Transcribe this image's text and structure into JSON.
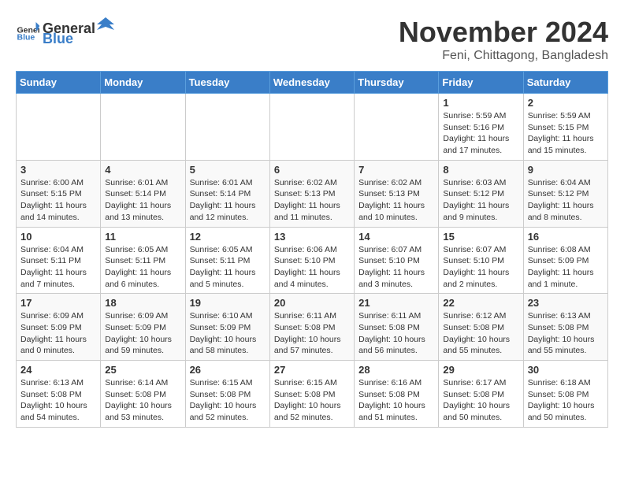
{
  "logo": {
    "general": "General",
    "blue": "Blue"
  },
  "title": "November 2024",
  "location": "Feni, Chittagong, Bangladesh",
  "headers": [
    "Sunday",
    "Monday",
    "Tuesday",
    "Wednesday",
    "Thursday",
    "Friday",
    "Saturday"
  ],
  "weeks": [
    [
      {
        "day": "",
        "info": ""
      },
      {
        "day": "",
        "info": ""
      },
      {
        "day": "",
        "info": ""
      },
      {
        "day": "",
        "info": ""
      },
      {
        "day": "",
        "info": ""
      },
      {
        "day": "1",
        "info": "Sunrise: 5:59 AM\nSunset: 5:16 PM\nDaylight: 11 hours and 17 minutes."
      },
      {
        "day": "2",
        "info": "Sunrise: 5:59 AM\nSunset: 5:15 PM\nDaylight: 11 hours and 15 minutes."
      }
    ],
    [
      {
        "day": "3",
        "info": "Sunrise: 6:00 AM\nSunset: 5:15 PM\nDaylight: 11 hours and 14 minutes."
      },
      {
        "day": "4",
        "info": "Sunrise: 6:01 AM\nSunset: 5:14 PM\nDaylight: 11 hours and 13 minutes."
      },
      {
        "day": "5",
        "info": "Sunrise: 6:01 AM\nSunset: 5:14 PM\nDaylight: 11 hours and 12 minutes."
      },
      {
        "day": "6",
        "info": "Sunrise: 6:02 AM\nSunset: 5:13 PM\nDaylight: 11 hours and 11 minutes."
      },
      {
        "day": "7",
        "info": "Sunrise: 6:02 AM\nSunset: 5:13 PM\nDaylight: 11 hours and 10 minutes."
      },
      {
        "day": "8",
        "info": "Sunrise: 6:03 AM\nSunset: 5:12 PM\nDaylight: 11 hours and 9 minutes."
      },
      {
        "day": "9",
        "info": "Sunrise: 6:04 AM\nSunset: 5:12 PM\nDaylight: 11 hours and 8 minutes."
      }
    ],
    [
      {
        "day": "10",
        "info": "Sunrise: 6:04 AM\nSunset: 5:11 PM\nDaylight: 11 hours and 7 minutes."
      },
      {
        "day": "11",
        "info": "Sunrise: 6:05 AM\nSunset: 5:11 PM\nDaylight: 11 hours and 6 minutes."
      },
      {
        "day": "12",
        "info": "Sunrise: 6:05 AM\nSunset: 5:11 PM\nDaylight: 11 hours and 5 minutes."
      },
      {
        "day": "13",
        "info": "Sunrise: 6:06 AM\nSunset: 5:10 PM\nDaylight: 11 hours and 4 minutes."
      },
      {
        "day": "14",
        "info": "Sunrise: 6:07 AM\nSunset: 5:10 PM\nDaylight: 11 hours and 3 minutes."
      },
      {
        "day": "15",
        "info": "Sunrise: 6:07 AM\nSunset: 5:10 PM\nDaylight: 11 hours and 2 minutes."
      },
      {
        "day": "16",
        "info": "Sunrise: 6:08 AM\nSunset: 5:09 PM\nDaylight: 11 hours and 1 minute."
      }
    ],
    [
      {
        "day": "17",
        "info": "Sunrise: 6:09 AM\nSunset: 5:09 PM\nDaylight: 11 hours and 0 minutes."
      },
      {
        "day": "18",
        "info": "Sunrise: 6:09 AM\nSunset: 5:09 PM\nDaylight: 10 hours and 59 minutes."
      },
      {
        "day": "19",
        "info": "Sunrise: 6:10 AM\nSunset: 5:09 PM\nDaylight: 10 hours and 58 minutes."
      },
      {
        "day": "20",
        "info": "Sunrise: 6:11 AM\nSunset: 5:08 PM\nDaylight: 10 hours and 57 minutes."
      },
      {
        "day": "21",
        "info": "Sunrise: 6:11 AM\nSunset: 5:08 PM\nDaylight: 10 hours and 56 minutes."
      },
      {
        "day": "22",
        "info": "Sunrise: 6:12 AM\nSunset: 5:08 PM\nDaylight: 10 hours and 55 minutes."
      },
      {
        "day": "23",
        "info": "Sunrise: 6:13 AM\nSunset: 5:08 PM\nDaylight: 10 hours and 55 minutes."
      }
    ],
    [
      {
        "day": "24",
        "info": "Sunrise: 6:13 AM\nSunset: 5:08 PM\nDaylight: 10 hours and 54 minutes."
      },
      {
        "day": "25",
        "info": "Sunrise: 6:14 AM\nSunset: 5:08 PM\nDaylight: 10 hours and 53 minutes."
      },
      {
        "day": "26",
        "info": "Sunrise: 6:15 AM\nSunset: 5:08 PM\nDaylight: 10 hours and 52 minutes."
      },
      {
        "day": "27",
        "info": "Sunrise: 6:15 AM\nSunset: 5:08 PM\nDaylight: 10 hours and 52 minutes."
      },
      {
        "day": "28",
        "info": "Sunrise: 6:16 AM\nSunset: 5:08 PM\nDaylight: 10 hours and 51 minutes."
      },
      {
        "day": "29",
        "info": "Sunrise: 6:17 AM\nSunset: 5:08 PM\nDaylight: 10 hours and 50 minutes."
      },
      {
        "day": "30",
        "info": "Sunrise: 6:18 AM\nSunset: 5:08 PM\nDaylight: 10 hours and 50 minutes."
      }
    ]
  ]
}
